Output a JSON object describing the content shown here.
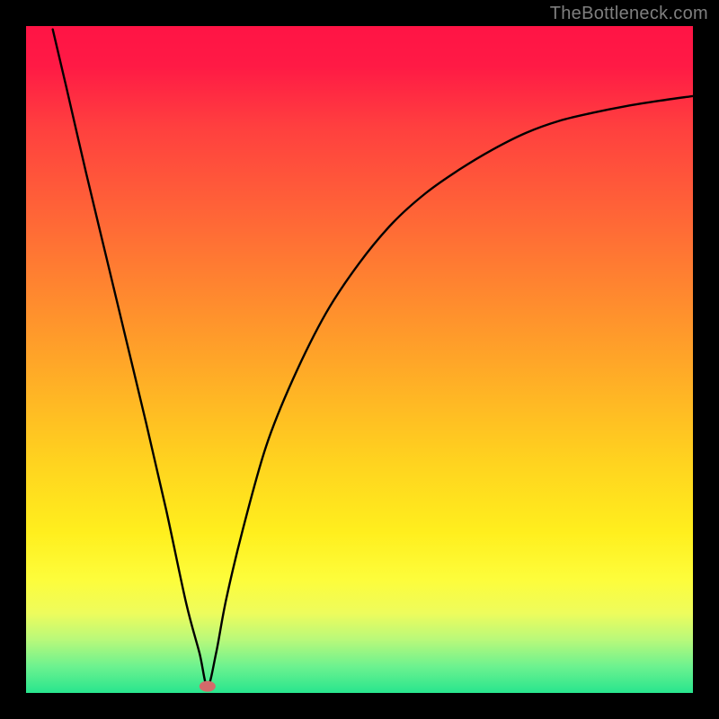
{
  "watermark": "TheBottleneck.com",
  "colors": {
    "frame": "#000000",
    "gradient_top": "#ff1445",
    "gradient_bottom": "#28e58e",
    "curve": "#000000",
    "marker": "#d46a6a"
  },
  "chart_data": {
    "type": "line",
    "title": "",
    "xlabel": "",
    "ylabel": "",
    "xlim": [
      0,
      1
    ],
    "ylim": [
      0,
      1
    ],
    "annotations": [
      {
        "text": "TheBottleneck.com",
        "position": "top-right"
      }
    ],
    "series": [
      {
        "name": "bottleneck-curve",
        "comment": "Black V-shaped curve. x and y are normalized 0..1 where (0,0) is bottom-left of the colored plot area. Curve descends steeply from near top-left to a minimum around x≈0.27, y≈0, then rises with decreasing slope toward upper-right.",
        "x": [
          0.04,
          0.06,
          0.09,
          0.12,
          0.15,
          0.18,
          0.21,
          0.24,
          0.26,
          0.272,
          0.285,
          0.3,
          0.325,
          0.36,
          0.4,
          0.45,
          0.5,
          0.55,
          0.6,
          0.65,
          0.7,
          0.75,
          0.8,
          0.85,
          0.9,
          0.95,
          1.0
        ],
        "y": [
          0.995,
          0.91,
          0.78,
          0.655,
          0.53,
          0.405,
          0.275,
          0.135,
          0.06,
          0.01,
          0.06,
          0.14,
          0.245,
          0.37,
          0.47,
          0.57,
          0.645,
          0.705,
          0.75,
          0.785,
          0.815,
          0.84,
          0.858,
          0.87,
          0.88,
          0.888,
          0.895
        ]
      }
    ],
    "marker": {
      "x": 0.272,
      "y": 0.01,
      "color": "#d46a6a",
      "rx": 9,
      "ry": 6
    }
  }
}
